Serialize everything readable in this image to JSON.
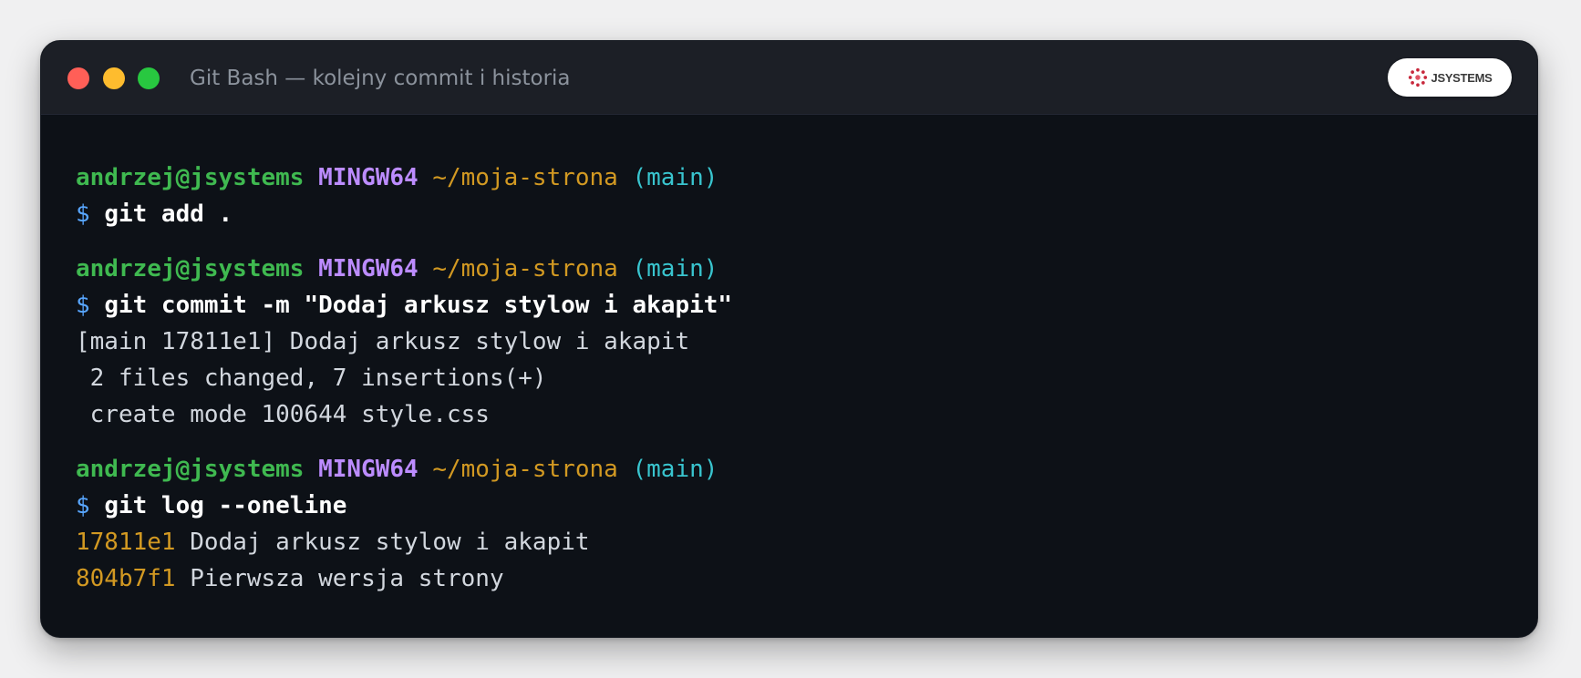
{
  "window": {
    "title": "Git Bash — kolejny commit i historia",
    "logo_text": "JSYSTEMS"
  },
  "colors": {
    "user": "#3fb950",
    "host": "#bc8cff",
    "path": "#d29922",
    "branch": "#39c5cf",
    "prompt_symbol": "#58a6ff",
    "hash": "#d29922"
  },
  "prompt": {
    "user_host": "andrzej@jsystems",
    "shell": "MINGW64",
    "path": "~/moja-strona",
    "branch": "(main)",
    "symbol": "$"
  },
  "blocks": [
    {
      "command": "git add .",
      "output": []
    },
    {
      "command": "git commit -m \"Dodaj arkusz stylow i akapit\"",
      "output": [
        "[main 17811e1] Dodaj arkusz stylow i akapit",
        " 2 files changed, 7 insertions(+)",
        " create mode 100644 style.css"
      ]
    },
    {
      "command": "git log --oneline",
      "log": [
        {
          "hash": "17811e1",
          "message": "Dodaj arkusz stylow i akapit"
        },
        {
          "hash": "804b7f1",
          "message": "Pierwsza wersja strony"
        }
      ]
    }
  ]
}
